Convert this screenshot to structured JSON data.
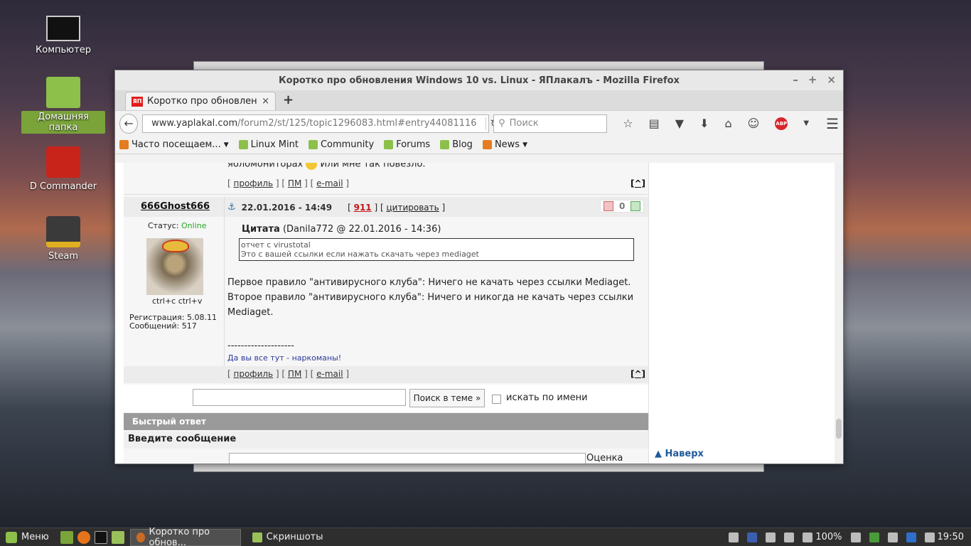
{
  "desktop": {
    "icons": [
      {
        "label": "Компьютер"
      },
      {
        "label": "Домашняя папка"
      },
      {
        "label": "D Commander"
      },
      {
        "label": "Steam"
      }
    ]
  },
  "window": {
    "title": "Коротко про обновления Windows 10 vs. Linux - ЯПлакалъ - Mozilla Firefox",
    "controls": [
      "–",
      "+",
      "×"
    ]
  },
  "tab": {
    "favicon": "ЯП",
    "title": "Коротко про обновлени...",
    "close": "×",
    "new_tab": "+"
  },
  "navbar": {
    "back_glyph": "←",
    "url_host": "www.yaplakal.com",
    "url_rest": "/forum2/st/125/topic1296083.html#entry44081116",
    "reload_glyph": "↻",
    "search_placeholder": "Поиск",
    "icons": [
      "star-icon",
      "reader-icon",
      "pocket-icon",
      "download-icon",
      "home-icon",
      "chat-icon",
      "abp-icon",
      "menu-icon"
    ],
    "abp_label": "ABP"
  },
  "bookmarks": [
    {
      "label": "Часто посещаем...",
      "dropdown": true
    },
    {
      "label": "Linux Mint"
    },
    {
      "label": "Community"
    },
    {
      "label": "Forums"
    },
    {
      "label": "Blog"
    },
    {
      "label": "News",
      "dropdown": true
    }
  ],
  "forum": {
    "prev_post_tail": "ябломониторах",
    "prev_post_tail2": "Или мне так повезло.",
    "links": {
      "profile": "профиль",
      "pm": "ПМ",
      "email": "e-mail",
      "up": "[^]"
    },
    "post": {
      "author": "666Ghost666",
      "status_label": "Статус:",
      "status_value": "Online",
      "avatar_caption": "ctrl+c ctrl+v",
      "reg_label": "Регистрация:",
      "reg_value": "5.08.11",
      "posts_label": "Сообщений:",
      "posts_value": "517",
      "date": "22.01.2016 - 14:49",
      "rating": "911",
      "cite": "цитировать",
      "votes": "0",
      "quote_label": "Цитата",
      "quote_meta": "(Danila772 @ 22.01.2016 - 14:36)",
      "quote_line1": "отчет с virustotal",
      "quote_line2": "Это с вашей ссылки если нажать скачать через mediaget",
      "body_line1": "Первое правило \"антивирусного клуба\": Ничего не качать через ссылки Mediaget.",
      "body_line2": "Второе правило \"антивирусного клуба\": Ничего и никогда не качать через ссылки",
      "body_line3": "Mediaget.",
      "sig_sep": "--------------------",
      "signature": "Да вы все тут - наркоманы!"
    },
    "search_button": "Поиск в теме »",
    "search_by_name": "искать по имени",
    "quick_reply": "Быстрый ответ",
    "enter_message": "Введите сообщение",
    "rate_topic": "Оценка темы",
    "to_top": "Наверх"
  },
  "taskbar": {
    "menu_label": "Меню",
    "tasks": [
      {
        "label": "Коротко про обнов..."
      },
      {
        "label": "Скриншоты"
      }
    ],
    "battery": "100%",
    "clock": "19:50"
  }
}
